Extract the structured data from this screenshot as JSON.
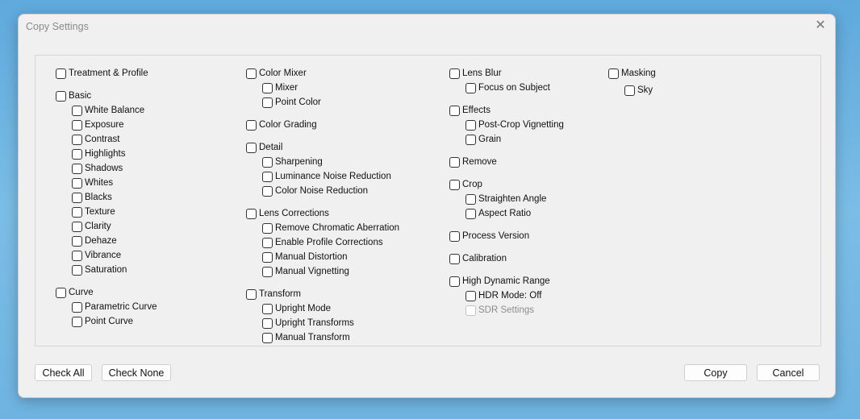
{
  "dialog": {
    "title": "Copy Settings",
    "close_icon": "close-icon"
  },
  "columns": [
    [
      {
        "label": "Treatment & Profile",
        "children": []
      },
      {
        "label": "Basic",
        "children": [
          "White Balance",
          "Exposure",
          "Contrast",
          "Highlights",
          "Shadows",
          "Whites",
          "Blacks",
          "Texture",
          "Clarity",
          "Dehaze",
          "Vibrance",
          "Saturation"
        ]
      },
      {
        "label": "Curve",
        "children": [
          "Parametric Curve",
          "Point Curve"
        ]
      }
    ],
    [
      {
        "label": "Color Mixer",
        "children": [
          "Mixer",
          "Point Color"
        ]
      },
      {
        "label": "Color Grading",
        "children": []
      },
      {
        "label": "Detail",
        "children": [
          "Sharpening",
          "Luminance Noise Reduction",
          "Color Noise Reduction"
        ]
      },
      {
        "label": "Lens Corrections",
        "children": [
          "Remove Chromatic Aberration",
          "Enable Profile Corrections",
          "Manual Distortion",
          "Manual Vignetting"
        ]
      },
      {
        "label": "Transform",
        "children": [
          "Upright Mode",
          "Upright Transforms",
          "Manual Transform"
        ]
      }
    ],
    [
      {
        "label": "Lens Blur",
        "children": [
          "Focus on Subject"
        ]
      },
      {
        "label": "Effects",
        "children": [
          "Post-Crop Vignetting",
          "Grain"
        ]
      },
      {
        "label": "Remove",
        "children": []
      },
      {
        "label": "Crop",
        "children": [
          "Straighten Angle",
          "Aspect Ratio"
        ]
      },
      {
        "label": "Process Version",
        "children": []
      },
      {
        "label": "Calibration",
        "children": []
      },
      {
        "label": "High Dynamic Range",
        "children": [
          "HDR Mode: Off",
          "SDR Settings"
        ],
        "disabled_children": [
          "SDR Settings"
        ]
      }
    ],
    [
      {
        "label": "Masking",
        "children": [
          "Sky"
        ]
      }
    ]
  ],
  "buttons": {
    "check_all": "Check All",
    "check_none": "Check None",
    "copy": "Copy",
    "cancel": "Cancel"
  }
}
